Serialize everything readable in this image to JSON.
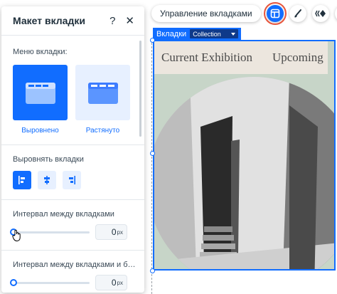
{
  "toolbar": {
    "manage_tabs_label": "Управление вкладками"
  },
  "selection": {
    "tag_label": "Вкладки",
    "dropdown_value": "Collection"
  },
  "widget": {
    "tabs": [
      "Current Exhibition",
      "Upcoming"
    ]
  },
  "panel": {
    "title": "Макет вкладки",
    "help_icon": "?",
    "close_icon": "✕",
    "menu_section_label": "Меню вкладки:",
    "layouts": [
      {
        "label": "Выровнено",
        "selected": true
      },
      {
        "label": "Растянуто",
        "selected": false
      }
    ],
    "align_section_label": "Выровнять вкладки",
    "align_options": [
      "left",
      "center",
      "right"
    ],
    "spacing_label": "Интервал между вкладками",
    "spacing_value": "0",
    "spacing_unit": "px",
    "spacing2_label": "Интервал между вкладками и б…",
    "spacing2_value": "0",
    "spacing2_unit": "px"
  },
  "colors": {
    "accent": "#116dff",
    "highlight": "#e8553c"
  }
}
